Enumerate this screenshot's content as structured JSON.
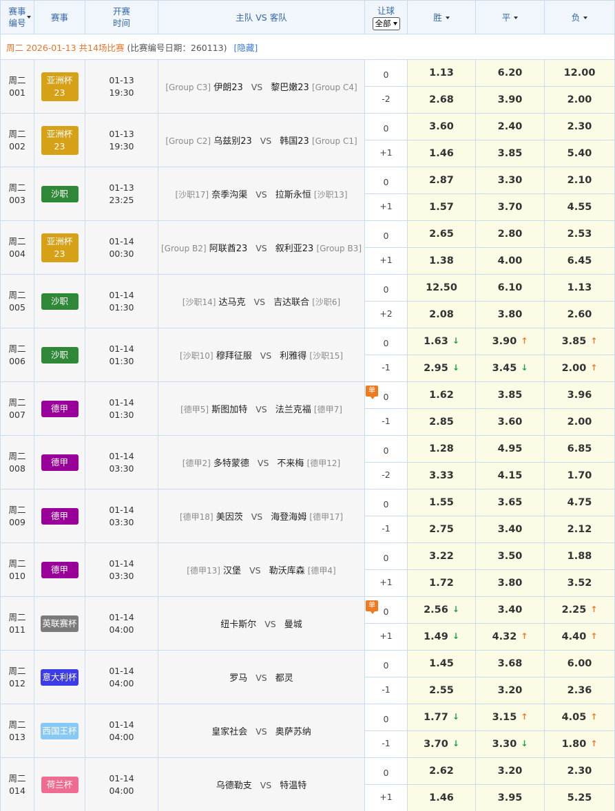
{
  "header": {
    "num": [
      "赛事",
      "编号"
    ],
    "league": "赛事",
    "start": [
      "开赛",
      "时间"
    ],
    "teams": "主队 VS 客队",
    "handicap": "让球",
    "handicap_select": "全部",
    "win": "胜",
    "draw": "平",
    "lose": "负"
  },
  "date_row": {
    "title": "周二 2026-01-13 共14场比赛",
    "note": "(比赛编号日期：260113)",
    "hide": "[隐藏]"
  },
  "colors": {
    "亚洲杯": "#d6a117",
    "沙职": "#2f8838",
    "德甲": "#990099",
    "英联赛杯": "#7b7b7b",
    "意大利杯": "#3c3ce6",
    "西国王杯": "#88c8f5",
    "荷兰杯": "#f06b92",
    "arrow_down": "#1aa33a",
    "arrow_up": "#f07a1f"
  },
  "matches": [
    {
      "day": "周二",
      "num": "001",
      "league": "亚洲杯",
      "league2": "23",
      "date": "01-13",
      "time": "19:30",
      "home_rank": "[Group C3]",
      "home": "伊朗23",
      "away": "黎巴嫩23",
      "away_rank": "[Group C4]",
      "h1": "0",
      "h2": "-2",
      "dan": false,
      "r1": [
        {
          "v": "1.13"
        },
        {
          "v": "6.20"
        },
        {
          "v": "12.00"
        }
      ],
      "r2": [
        {
          "v": "2.68"
        },
        {
          "v": "3.90"
        },
        {
          "v": "2.00"
        }
      ]
    },
    {
      "day": "周二",
      "num": "002",
      "league": "亚洲杯",
      "league2": "23",
      "date": "01-13",
      "time": "19:30",
      "home_rank": "[Group C2]",
      "home": "乌兹别23",
      "away": "韩国23",
      "away_rank": "[Group C1]",
      "h1": "0",
      "h2": "+1",
      "dan": false,
      "r1": [
        {
          "v": "3.60"
        },
        {
          "v": "2.40"
        },
        {
          "v": "2.30"
        }
      ],
      "r2": [
        {
          "v": "1.46"
        },
        {
          "v": "3.85"
        },
        {
          "v": "5.40"
        }
      ]
    },
    {
      "day": "周二",
      "num": "003",
      "league": "沙职",
      "league2": "",
      "date": "01-13",
      "time": "23:25",
      "home_rank": "[沙职17]",
      "home": "奈季沟渠",
      "away": "拉斯永恒",
      "away_rank": "[沙职13]",
      "h1": "0",
      "h2": "+1",
      "dan": false,
      "r1": [
        {
          "v": "2.87"
        },
        {
          "v": "3.30"
        },
        {
          "v": "2.10"
        }
      ],
      "r2": [
        {
          "v": "1.57"
        },
        {
          "v": "3.70"
        },
        {
          "v": "4.55"
        }
      ]
    },
    {
      "day": "周二",
      "num": "004",
      "league": "亚洲杯",
      "league2": "23",
      "date": "01-14",
      "time": "00:30",
      "home_rank": "[Group B2]",
      "home": "阿联酋23",
      "away": "叙利亚23",
      "away_rank": "[Group B3]",
      "h1": "0",
      "h2": "+1",
      "dan": false,
      "r1": [
        {
          "v": "2.65"
        },
        {
          "v": "2.80"
        },
        {
          "v": "2.53"
        }
      ],
      "r2": [
        {
          "v": "1.38"
        },
        {
          "v": "4.00"
        },
        {
          "v": "6.45"
        }
      ]
    },
    {
      "day": "周二",
      "num": "005",
      "league": "沙职",
      "league2": "",
      "date": "01-14",
      "time": "01:30",
      "home_rank": "[沙职14]",
      "home": "达马克",
      "away": "吉达联合",
      "away_rank": "[沙职6]",
      "h1": "0",
      "h2": "+2",
      "dan": false,
      "r1": [
        {
          "v": "12.50"
        },
        {
          "v": "6.10"
        },
        {
          "v": "1.13"
        }
      ],
      "r2": [
        {
          "v": "2.08"
        },
        {
          "v": "3.80"
        },
        {
          "v": "2.60"
        }
      ]
    },
    {
      "day": "周二",
      "num": "006",
      "league": "沙职",
      "league2": "",
      "date": "01-14",
      "time": "01:30",
      "home_rank": "[沙职10]",
      "home": "穆拜征服",
      "away": "利雅得",
      "away_rank": "[沙职15]",
      "h1": "0",
      "h2": "-1",
      "dan": false,
      "r1": [
        {
          "v": "1.63",
          "a": "down"
        },
        {
          "v": "3.90",
          "a": "up"
        },
        {
          "v": "3.85",
          "a": "up"
        }
      ],
      "r2": [
        {
          "v": "2.95",
          "a": "down"
        },
        {
          "v": "3.45",
          "a": "down"
        },
        {
          "v": "2.00",
          "a": "up"
        }
      ]
    },
    {
      "day": "周二",
      "num": "007",
      "league": "德甲",
      "league2": "",
      "date": "01-14",
      "time": "01:30",
      "home_rank": "[德甲5]",
      "home": "斯图加特",
      "away": "法兰克福",
      "away_rank": "[德甲7]",
      "h1": "0",
      "h2": "-1",
      "dan": true,
      "dan_label": "单",
      "r1": [
        {
          "v": "1.62"
        },
        {
          "v": "3.85"
        },
        {
          "v": "3.96"
        }
      ],
      "r2": [
        {
          "v": "2.85"
        },
        {
          "v": "3.60"
        },
        {
          "v": "2.00"
        }
      ]
    },
    {
      "day": "周二",
      "num": "008",
      "league": "德甲",
      "league2": "",
      "date": "01-14",
      "time": "03:30",
      "home_rank": "[德甲2]",
      "home": "多特蒙德",
      "away": "不来梅",
      "away_rank": "[德甲12]",
      "h1": "0",
      "h2": "-2",
      "dan": false,
      "r1": [
        {
          "v": "1.28"
        },
        {
          "v": "4.95"
        },
        {
          "v": "6.85"
        }
      ],
      "r2": [
        {
          "v": "3.33"
        },
        {
          "v": "4.15"
        },
        {
          "v": "1.70"
        }
      ]
    },
    {
      "day": "周二",
      "num": "009",
      "league": "德甲",
      "league2": "",
      "date": "01-14",
      "time": "03:30",
      "home_rank": "[德甲18]",
      "home": "美因茨",
      "away": "海登海姆",
      "away_rank": "[德甲17]",
      "h1": "0",
      "h2": "-1",
      "dan": false,
      "r1": [
        {
          "v": "1.55"
        },
        {
          "v": "3.65"
        },
        {
          "v": "4.75"
        }
      ],
      "r2": [
        {
          "v": "2.75"
        },
        {
          "v": "3.40"
        },
        {
          "v": "2.12"
        }
      ]
    },
    {
      "day": "周二",
      "num": "010",
      "league": "德甲",
      "league2": "",
      "date": "01-14",
      "time": "03:30",
      "home_rank": "[德甲13]",
      "home": "汉堡",
      "away": "勒沃库森",
      "away_rank": "[德甲4]",
      "h1": "0",
      "h2": "+1",
      "dan": false,
      "r1": [
        {
          "v": "3.22"
        },
        {
          "v": "3.50"
        },
        {
          "v": "1.88"
        }
      ],
      "r2": [
        {
          "v": "1.72"
        },
        {
          "v": "3.80"
        },
        {
          "v": "3.52"
        }
      ]
    },
    {
      "day": "周二",
      "num": "011",
      "league": "英联赛杯",
      "league2": "",
      "date": "01-14",
      "time": "04:00",
      "home_rank": "",
      "home": "纽卡斯尔",
      "away": "曼城",
      "away_rank": "",
      "h1": "0",
      "h2": "+1",
      "dan": true,
      "dan_label": "单",
      "r1": [
        {
          "v": "2.56",
          "a": "down"
        },
        {
          "v": "3.40"
        },
        {
          "v": "2.25",
          "a": "up"
        }
      ],
      "r2": [
        {
          "v": "1.49",
          "a": "down"
        },
        {
          "v": "4.32",
          "a": "up"
        },
        {
          "v": "4.40",
          "a": "up"
        }
      ]
    },
    {
      "day": "周二",
      "num": "012",
      "league": "意大利杯",
      "league2": "",
      "date": "01-14",
      "time": "04:00",
      "home_rank": "",
      "home": "罗马",
      "away": "都灵",
      "away_rank": "",
      "h1": "0",
      "h2": "-1",
      "dan": false,
      "r1": [
        {
          "v": "1.45"
        },
        {
          "v": "3.68"
        },
        {
          "v": "6.00"
        }
      ],
      "r2": [
        {
          "v": "2.55"
        },
        {
          "v": "3.20"
        },
        {
          "v": "2.36"
        }
      ]
    },
    {
      "day": "周二",
      "num": "013",
      "league": "西国王杯",
      "league2": "",
      "date": "01-14",
      "time": "04:00",
      "home_rank": "",
      "home": "皇家社会",
      "away": "奥萨苏纳",
      "away_rank": "",
      "h1": "0",
      "h2": "-1",
      "dan": false,
      "r1": [
        {
          "v": "1.77",
          "a": "down"
        },
        {
          "v": "3.15",
          "a": "up"
        },
        {
          "v": "4.05",
          "a": "up"
        }
      ],
      "r2": [
        {
          "v": "3.70",
          "a": "down"
        },
        {
          "v": "3.30",
          "a": "down"
        },
        {
          "v": "1.80",
          "a": "up"
        }
      ]
    },
    {
      "day": "周二",
      "num": "014",
      "league": "荷兰杯",
      "league2": "",
      "date": "01-14",
      "time": "04:00",
      "home_rank": "",
      "home": "乌德勒支",
      "away": "特温特",
      "away_rank": "",
      "h1": "0",
      "h2": "+1",
      "dan": false,
      "r1": [
        {
          "v": "2.62"
        },
        {
          "v": "3.20"
        },
        {
          "v": "2.30"
        }
      ],
      "r2": [
        {
          "v": "1.46"
        },
        {
          "v": "3.95"
        },
        {
          "v": "5.25"
        }
      ]
    }
  ]
}
